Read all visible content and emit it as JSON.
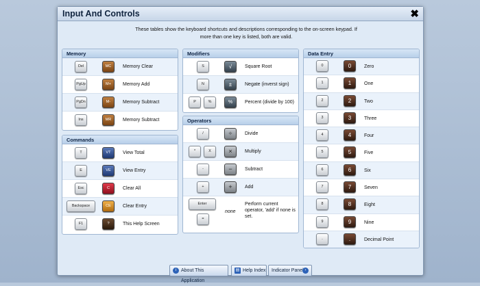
{
  "title": "Input And Controls",
  "intro": "These tables show the keyboard shortcuts and descriptions corresponding to the on-screen keypad. If more than one key is listed, both are valid.",
  "memory": {
    "header": "Memory",
    "rows": [
      {
        "key": "Del",
        "ckey": "MC",
        "color": "#9a5a1e",
        "desc": "Memory Clear"
      },
      {
        "key": "PgUp",
        "ckey": "M+",
        "color": "#9a5a1e",
        "desc": "Memory Add"
      },
      {
        "key": "PgDn",
        "ckey": "M-",
        "color": "#9a5a1e",
        "desc": "Memory Subtract"
      },
      {
        "key": "Ins",
        "ckey": "MR",
        "color": "#9a5a1e",
        "desc": "Memory Subtract"
      }
    ]
  },
  "commands": {
    "header": "Commands",
    "rows": [
      {
        "key": "T",
        "ckey": "VT",
        "color": "#2c4a8a",
        "desc": "View Total"
      },
      {
        "key": "E",
        "ckey": "VE",
        "color": "#2c4a8a",
        "desc": "View Entry"
      },
      {
        "key": "Esc",
        "ckey": "C",
        "color": "#b0182a",
        "desc": "Clear All"
      },
      {
        "key": "Backspace",
        "ckey": "CE",
        "color": "#c7861f",
        "desc": "Clear Entry"
      },
      {
        "key": "F1",
        "ckey": "?",
        "color": "#3b2a1a",
        "desc": "This Help Screen"
      }
    ]
  },
  "modifiers": {
    "header": "Modifiers",
    "rows": [
      {
        "keys": [
          "S"
        ],
        "ckey": "√",
        "desc": "Square Root"
      },
      {
        "keys": [
          "N"
        ],
        "ckey": "±",
        "desc": "Negate (inverst sign)"
      },
      {
        "keys": [
          "P",
          "%"
        ],
        "ckey": "%",
        "desc": "Percent (divide by 100)"
      }
    ]
  },
  "operators": {
    "header": "Operators",
    "rows": [
      {
        "keys": [
          "/"
        ],
        "ckey": "÷",
        "desc": "Divide"
      },
      {
        "keys": [
          "*",
          "X"
        ],
        "ckey": "×",
        "desc": "Multiply"
      },
      {
        "keys": [
          "-"
        ],
        "ckey": "−",
        "desc": "Subtract"
      },
      {
        "keys": [
          "+"
        ],
        "ckey": "+",
        "desc": "Add"
      }
    ],
    "enter": {
      "keys": [
        "Enter",
        "="
      ],
      "none": "none",
      "desc": "Perform current operator, 'add' if none is set."
    }
  },
  "data_entry": {
    "header": "Data Entry",
    "rows": [
      {
        "key": "0",
        "ckey": "0",
        "desc": "Zero"
      },
      {
        "key": "1",
        "ckey": "1",
        "desc": "One"
      },
      {
        "key": "2",
        "ckey": "2",
        "desc": "Two"
      },
      {
        "key": "3",
        "ckey": "3",
        "desc": "Three"
      },
      {
        "key": "4",
        "ckey": "4",
        "desc": "Four"
      },
      {
        "key": "5",
        "ckey": "5",
        "desc": "Five"
      },
      {
        "key": "6",
        "ckey": "6",
        "desc": "Six"
      },
      {
        "key": "7",
        "ckey": "7",
        "desc": "Seven"
      },
      {
        "key": "8",
        "ckey": "8",
        "desc": "Eight"
      },
      {
        "key": "9",
        "ckey": "9",
        "desc": "Nine"
      },
      {
        "key": ".",
        "ckey": ".",
        "desc": "Decimal Point"
      }
    ]
  },
  "buttons": {
    "about": "About This Application",
    "help": "Help Index",
    "indicator": "Indicator Panel"
  },
  "colors": {
    "data_key": "#4a2a1c",
    "operator_key": "#7f8489",
    "modifier_key": "#3f4f5c"
  }
}
